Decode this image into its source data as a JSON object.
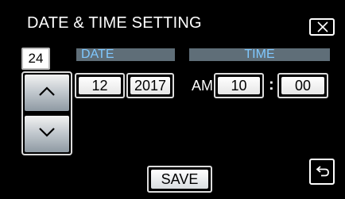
{
  "header": {
    "title": "DATE & TIME SETTING"
  },
  "icons": {
    "close": "close-icon",
    "up": "chevron-up-icon",
    "down": "chevron-down-icon",
    "back": "return-icon"
  },
  "nav": {
    "day_value": "24"
  },
  "date": {
    "label": "DATE",
    "month": "12",
    "year": "2017"
  },
  "time": {
    "label": "TIME",
    "ampm": "AM",
    "hour": "10",
    "separator": ":",
    "minute": "00"
  },
  "footer": {
    "save_label": "SAVE"
  },
  "colors": {
    "background": "#000000",
    "label_accent": "#7fc8ff",
    "bar": "#5f6e78"
  }
}
